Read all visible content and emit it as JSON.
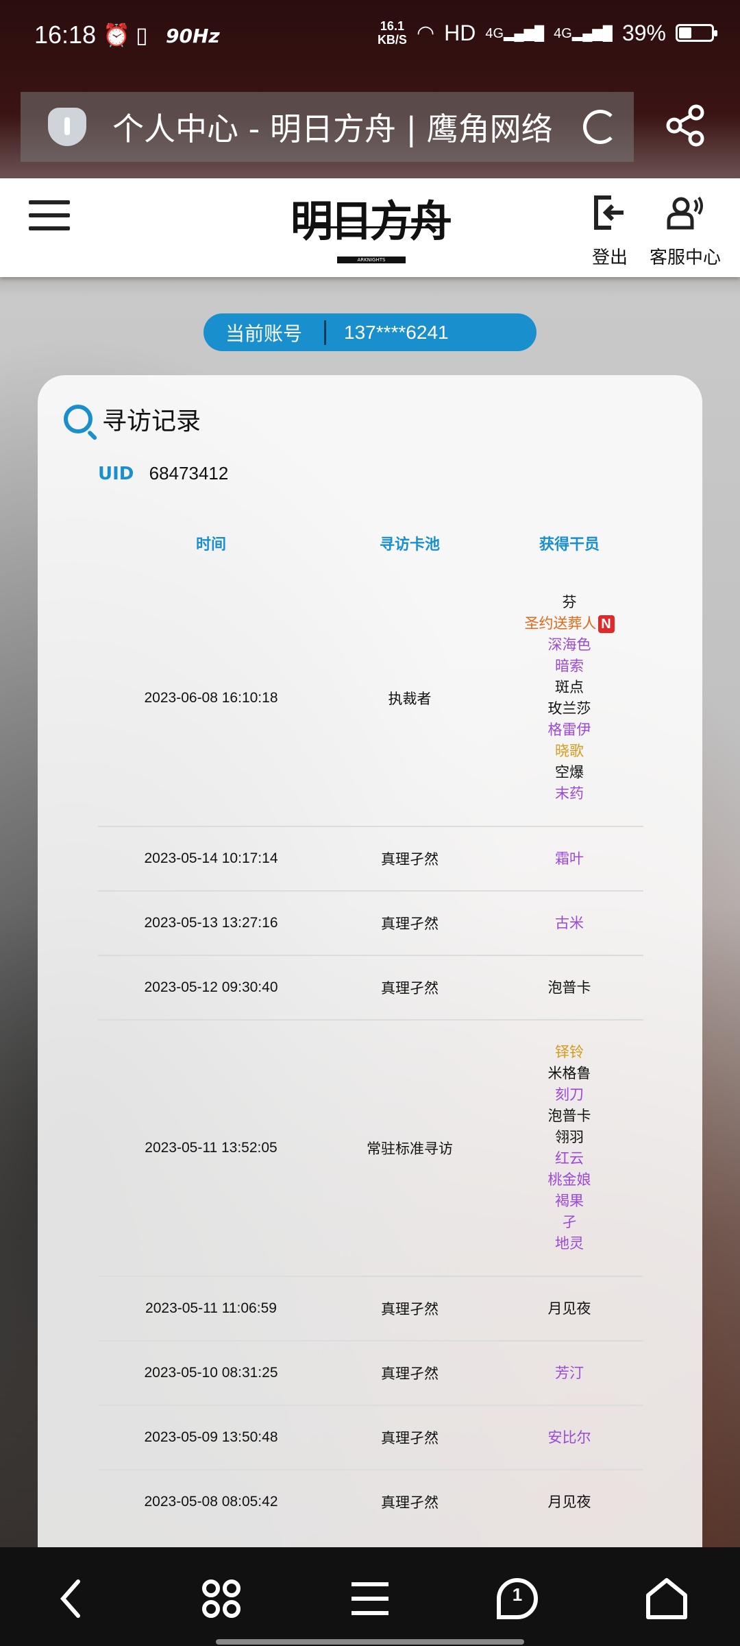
{
  "status_bar": {
    "time": "16:18",
    "refresh_rate": "90Hz",
    "net_speed_value": "16.1",
    "net_speed_unit": "KB/S",
    "network": "HD",
    "signal_1": "4G",
    "signal_2": "4G",
    "battery_percent": "39%",
    "battery_level": 0.39
  },
  "browser": {
    "page_title": "个人中心 - 明日方舟 | 鹰角网络"
  },
  "header": {
    "logo_text": "明日方舟",
    "logo_subtext": "ARKNIGHTS",
    "logout_label": "登出",
    "service_label": "客服中心"
  },
  "account": {
    "label": "当前账号",
    "value": "137****6241"
  },
  "record": {
    "title": "寻访记录",
    "uid_label": "UID",
    "uid_value": "68473412",
    "columns": [
      "时间",
      "寻访卡池",
      "获得干员"
    ],
    "rows": [
      {
        "time": "2023-06-08 16:10:18",
        "pool": "执裁者",
        "operators": [
          {
            "name": "芬",
            "rarity": 3
          },
          {
            "name": "圣约送葬人",
            "rarity": 6,
            "new": "N"
          },
          {
            "name": "深海色",
            "rarity": 4
          },
          {
            "name": "暗索",
            "rarity": 4
          },
          {
            "name": "斑点",
            "rarity": 3
          },
          {
            "name": "玫兰莎",
            "rarity": 3
          },
          {
            "name": "格雷伊",
            "rarity": 4
          },
          {
            "name": "晓歌",
            "rarity": 5
          },
          {
            "name": "空爆",
            "rarity": 3
          },
          {
            "name": "末药",
            "rarity": 4
          }
        ]
      },
      {
        "time": "2023-05-14 10:17:14",
        "pool": "真理孑然",
        "operators": [
          {
            "name": "霜叶",
            "rarity": 4
          }
        ]
      },
      {
        "time": "2023-05-13 13:27:16",
        "pool": "真理孑然",
        "operators": [
          {
            "name": "古米",
            "rarity": 4
          }
        ]
      },
      {
        "time": "2023-05-12 09:30:40",
        "pool": "真理孑然",
        "operators": [
          {
            "name": "泡普卡",
            "rarity": 3
          }
        ]
      },
      {
        "time": "2023-05-11 13:52:05",
        "pool": "常驻标准寻访",
        "operators": [
          {
            "name": "铎铃",
            "rarity": 5
          },
          {
            "name": "米格鲁",
            "rarity": 3
          },
          {
            "name": "刻刀",
            "rarity": 4
          },
          {
            "name": "泡普卡",
            "rarity": 3
          },
          {
            "name": "翎羽",
            "rarity": 3
          },
          {
            "name": "红云",
            "rarity": 4
          },
          {
            "name": "桃金娘",
            "rarity": 4
          },
          {
            "name": "褐果",
            "rarity": 4
          },
          {
            "name": "孑",
            "rarity": 4
          },
          {
            "name": "地灵",
            "rarity": 4
          }
        ]
      },
      {
        "time": "2023-05-11 11:06:59",
        "pool": "真理孑然",
        "operators": [
          {
            "name": "月见夜",
            "rarity": 3
          }
        ]
      },
      {
        "time": "2023-05-10 08:31:25",
        "pool": "真理孑然",
        "operators": [
          {
            "name": "芳汀",
            "rarity": 4
          }
        ]
      },
      {
        "time": "2023-05-09 13:50:48",
        "pool": "真理孑然",
        "operators": [
          {
            "name": "安比尔",
            "rarity": 4
          }
        ]
      },
      {
        "time": "2023-05-08 08:05:42",
        "pool": "真理孑然",
        "operators": [
          {
            "name": "月见夜",
            "rarity": 3
          }
        ]
      }
    ]
  },
  "bottom_nav": {
    "tab_count": "1",
    "icons": [
      "back-icon",
      "apps-icon",
      "menu-icon",
      "tabs-icon",
      "home-icon"
    ]
  },
  "colors": {
    "accent": "#1a8fcd",
    "rarity_3": "#111111",
    "rarity_4": "#9b49d9",
    "rarity_5": "#d39c1c",
    "rarity_6": "#e06a17",
    "new_badge": "#e02a2a"
  }
}
